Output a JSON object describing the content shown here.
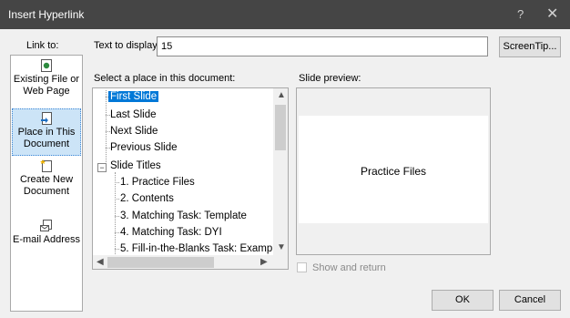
{
  "dialog": {
    "title": "Insert Hyperlink",
    "help": "?",
    "close": "✕"
  },
  "link_to": {
    "label": "Link to:",
    "items": [
      {
        "label": "Existing File or Web Page",
        "icon": "web-page-icon"
      },
      {
        "label": "Place in This Document",
        "icon": "document-place-icon",
        "selected": true
      },
      {
        "label": "Create New Document",
        "icon": "new-document-icon"
      },
      {
        "label": "E-mail Address",
        "icon": "email-icon"
      }
    ]
  },
  "text_to_display": {
    "label": "Text to display:",
    "value": "15"
  },
  "buttons": {
    "screentip": "ScreenTip...",
    "ok": "OK",
    "cancel": "Cancel"
  },
  "place": {
    "label": "Select a place in this document:",
    "tree": [
      {
        "label": "First Slide",
        "selected": true
      },
      {
        "label": "Last Slide"
      },
      {
        "label": "Next Slide"
      },
      {
        "label": "Previous Slide"
      },
      {
        "label": "Slide Titles",
        "expander": "⊟"
      },
      {
        "label": "1. Practice Files"
      },
      {
        "label": "2. Contents"
      },
      {
        "label": "3. Matching Task: Template"
      },
      {
        "label": "4. Matching Task: DYI"
      },
      {
        "label": "5. Fill-in-the-Blanks Task: Examp"
      }
    ]
  },
  "preview": {
    "label": "Slide preview:",
    "slide_text": "Practice Files",
    "show_and_return": "Show and return"
  },
  "colors": {
    "titlebar": "#454545",
    "selection": "#0078d7",
    "sidebar_selected": "#cce4f7"
  }
}
